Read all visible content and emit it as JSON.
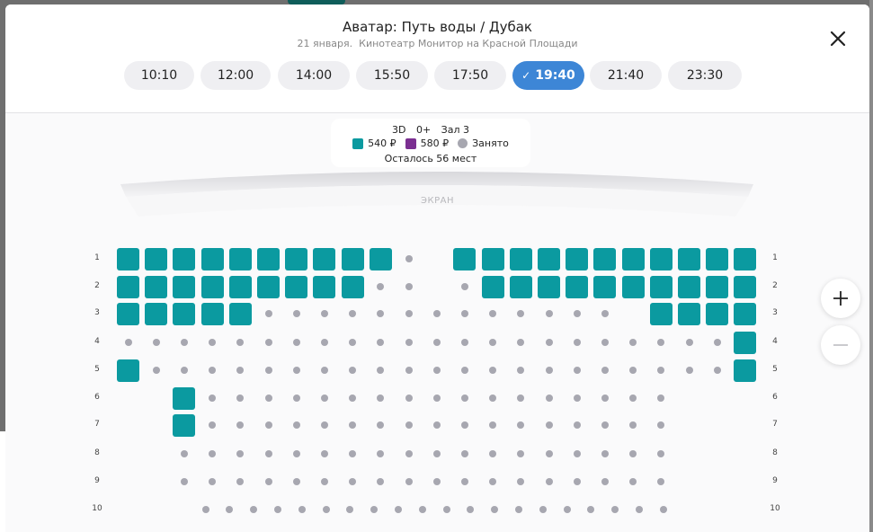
{
  "movie": {
    "title": "Аватар: Путь воды / Дубак",
    "date": "21 января.",
    "cinema": "Кинотеатр Монитор на Красной Площади"
  },
  "times": [
    {
      "label": "10:10",
      "selected": false
    },
    {
      "label": "12:00",
      "selected": false
    },
    {
      "label": "14:00",
      "selected": false
    },
    {
      "label": "15:50",
      "selected": false
    },
    {
      "label": "17:50",
      "selected": false
    },
    {
      "label": "19:40",
      "selected": true
    },
    {
      "label": "21:40",
      "selected": false
    },
    {
      "label": "23:30",
      "selected": false
    }
  ],
  "info": {
    "format": "3D",
    "age": "0+",
    "hall": "Зал 3",
    "remaining": "Осталось 56 мест"
  },
  "legend": [
    {
      "label": "540 ₽",
      "color": "#0b9aa0",
      "kind": "seat"
    },
    {
      "label": "580 ₽",
      "color": "#7b2f91",
      "kind": "seat"
    },
    {
      "label": "Занято",
      "color": "#a7a7b0",
      "kind": "taken"
    }
  ],
  "screen_label": "ЭКРАН",
  "colors": {
    "free": "#0b9aa0",
    "taken": "#a7a7b0",
    "accent": "#3d86d6"
  },
  "rows": [
    {
      "label": "1",
      "seats": "FFFFFFFFFFX-FFFFFFFFFFF"
    },
    {
      "label": "2",
      "seats": "FFFFFFFFFXX-XFFFFFFFFFF"
    },
    {
      "label": "3",
      "seats": "FFFFFXXXXXXXXXXXXXFFFF"
    },
    {
      "label": "4",
      "seats": "XXXXXXXXXXXXXXXXXXXXXXF"
    },
    {
      "label": "5",
      "seats": "FXXXXXXXXXXXXXXXXXXXXXF"
    },
    {
      "label": "6",
      "seats": "..FXXXXXXXXXXXXXXXXX"
    },
    {
      "label": "7",
      "seats": "..FXXXXXXXXXXXXXXXXX"
    },
    {
      "label": "8",
      "seats": "..XXXXXXXXXXXXXXXXXX"
    },
    {
      "label": "9",
      "seats": "..XXXXXXXXXXXXXXXXXX"
    },
    {
      "label": "10",
      "seats": "XXXXXXXXXXXXXXXXXXXX"
    }
  ]
}
